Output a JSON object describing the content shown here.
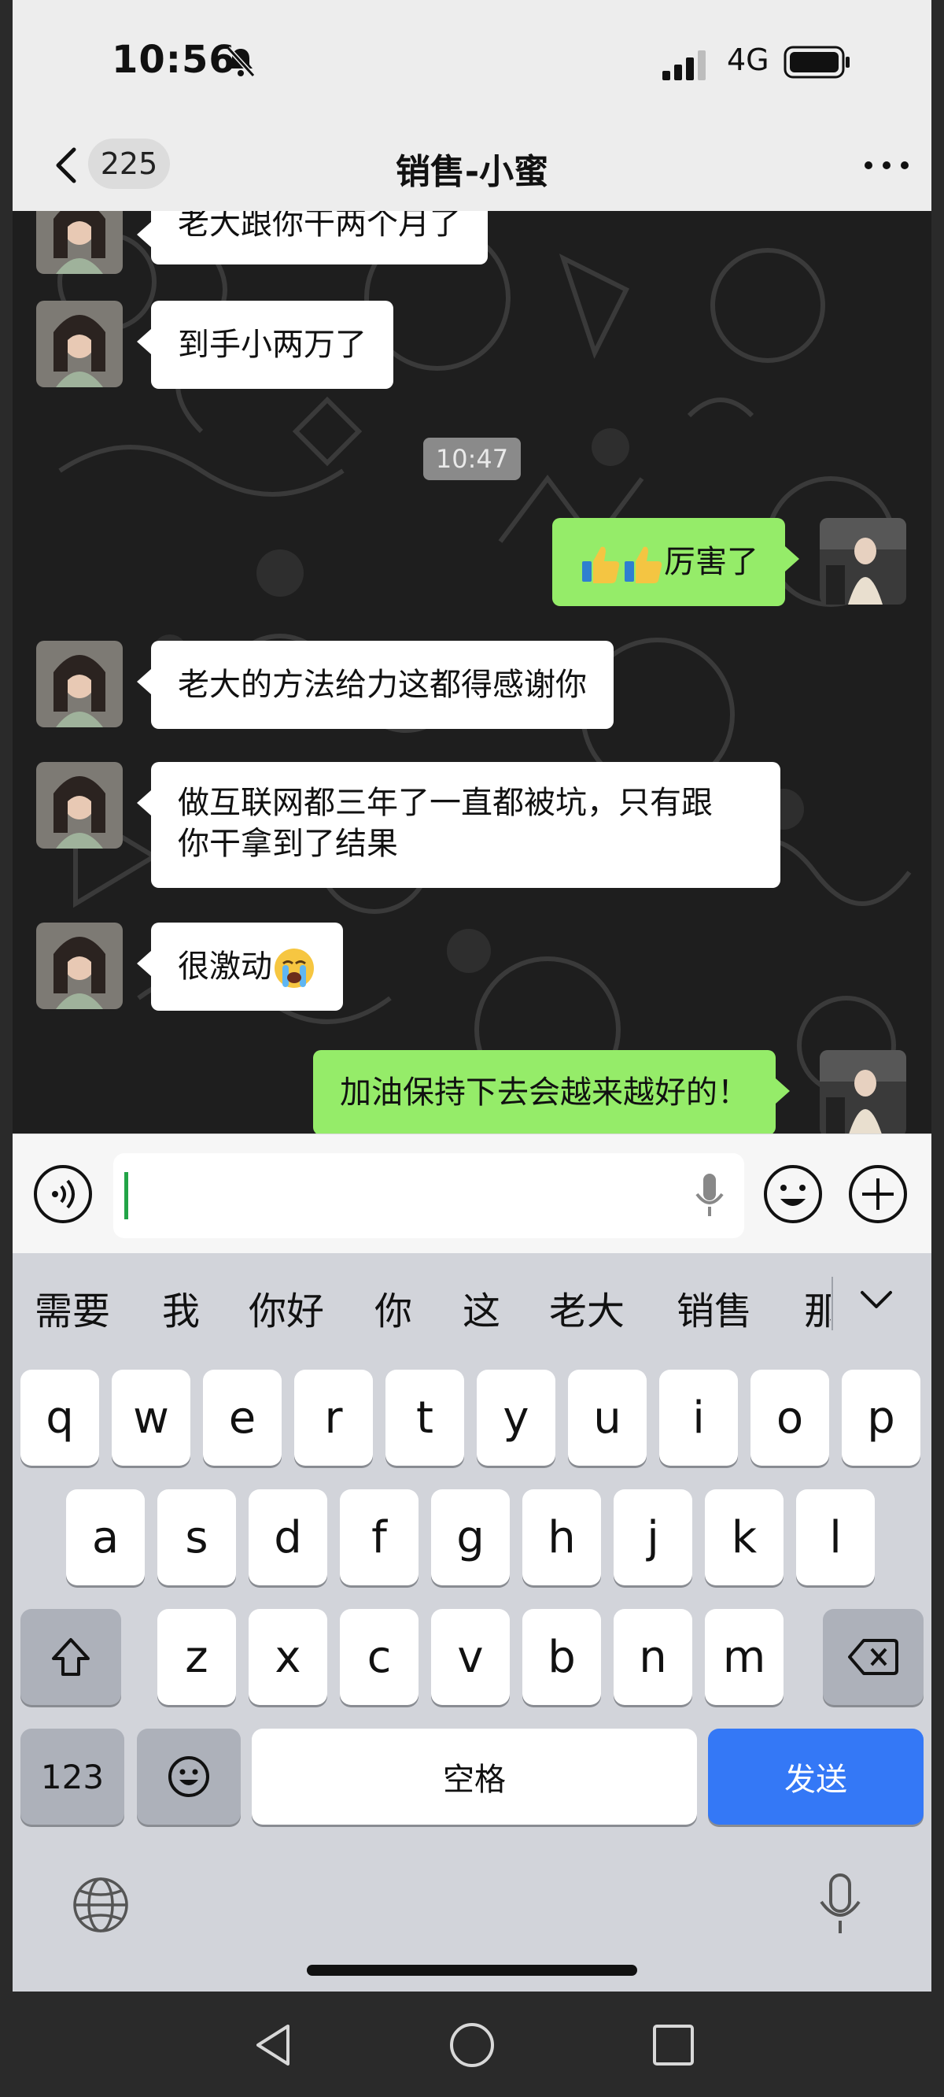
{
  "status_bar": {
    "time": "10:56",
    "network": "4G",
    "icons": [
      "bell-muted-icon",
      "signal-icon",
      "battery-icon"
    ]
  },
  "nav": {
    "unread_count": "225",
    "title": "销售-小蜜",
    "icons": [
      "back-icon",
      "more-icon"
    ]
  },
  "messages": [
    {
      "side": "in",
      "text": "老大跟你干两个月了"
    },
    {
      "side": "in",
      "text": "到手小两万了"
    },
    {
      "type": "time",
      "text": "10:47"
    },
    {
      "side": "out",
      "text": "厉害了",
      "emoji": [
        "thumbs-up",
        "thumbs-up"
      ]
    },
    {
      "side": "in",
      "text": "老大的方法给力这都得感谢你"
    },
    {
      "side": "in",
      "text_line1": "做互联网都三年了一直都被坑，只有跟",
      "text_line2": "你干拿到了结果"
    },
    {
      "side": "in",
      "text": "很激动",
      "emoji": [
        "loudly-crying"
      ]
    },
    {
      "side": "out",
      "text": "加油保持下去会越来越好的！"
    }
  ],
  "input_bar": {
    "value": "",
    "icons": [
      "voice-icon",
      "mic-icon",
      "emoji-icon",
      "plus-icon"
    ]
  },
  "keyboard": {
    "candidates": [
      "需要",
      "我",
      "你好",
      "你",
      "这",
      "老大",
      "销售",
      "那"
    ],
    "row1": [
      "q",
      "w",
      "e",
      "r",
      "t",
      "y",
      "u",
      "i",
      "o",
      "p"
    ],
    "row2": [
      "a",
      "s",
      "d",
      "f",
      "g",
      "h",
      "j",
      "k",
      "l"
    ],
    "row3": [
      "z",
      "x",
      "c",
      "v",
      "b",
      "n",
      "m"
    ],
    "numbers_label": "123",
    "space_label": "空格",
    "send_label": "发送",
    "send_color": "#3478f6"
  },
  "colors": {
    "out_bubble": "#95ec69",
    "in_bubble": "#ffffff",
    "header_bg": "#ededed"
  }
}
